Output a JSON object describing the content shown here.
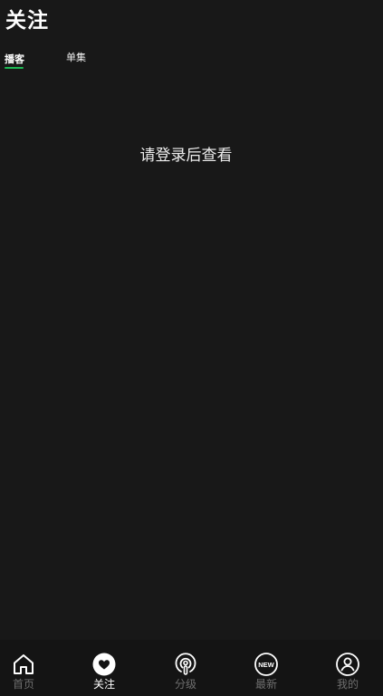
{
  "header": {
    "title": "关注"
  },
  "tabs": [
    {
      "label": "播客",
      "active": true
    },
    {
      "label": "单集",
      "active": false
    }
  ],
  "main": {
    "empty_message": "请登录后查看"
  },
  "bottom_nav": {
    "items": [
      {
        "label": "首页",
        "icon": "home-icon",
        "active": false
      },
      {
        "label": "关注",
        "icon": "heart-icon",
        "active": true
      },
      {
        "label": "分级",
        "icon": "podcast-icon",
        "active": false
      },
      {
        "label": "最新",
        "icon": "new-badge-icon",
        "active": false
      },
      {
        "label": "我的",
        "icon": "user-icon",
        "active": false
      }
    ],
    "new_badge_text": "NEW"
  },
  "colors": {
    "background": "#181818",
    "accent": "#1db954",
    "nav_inactive": "#6e6e6e",
    "text": "#ffffff"
  }
}
